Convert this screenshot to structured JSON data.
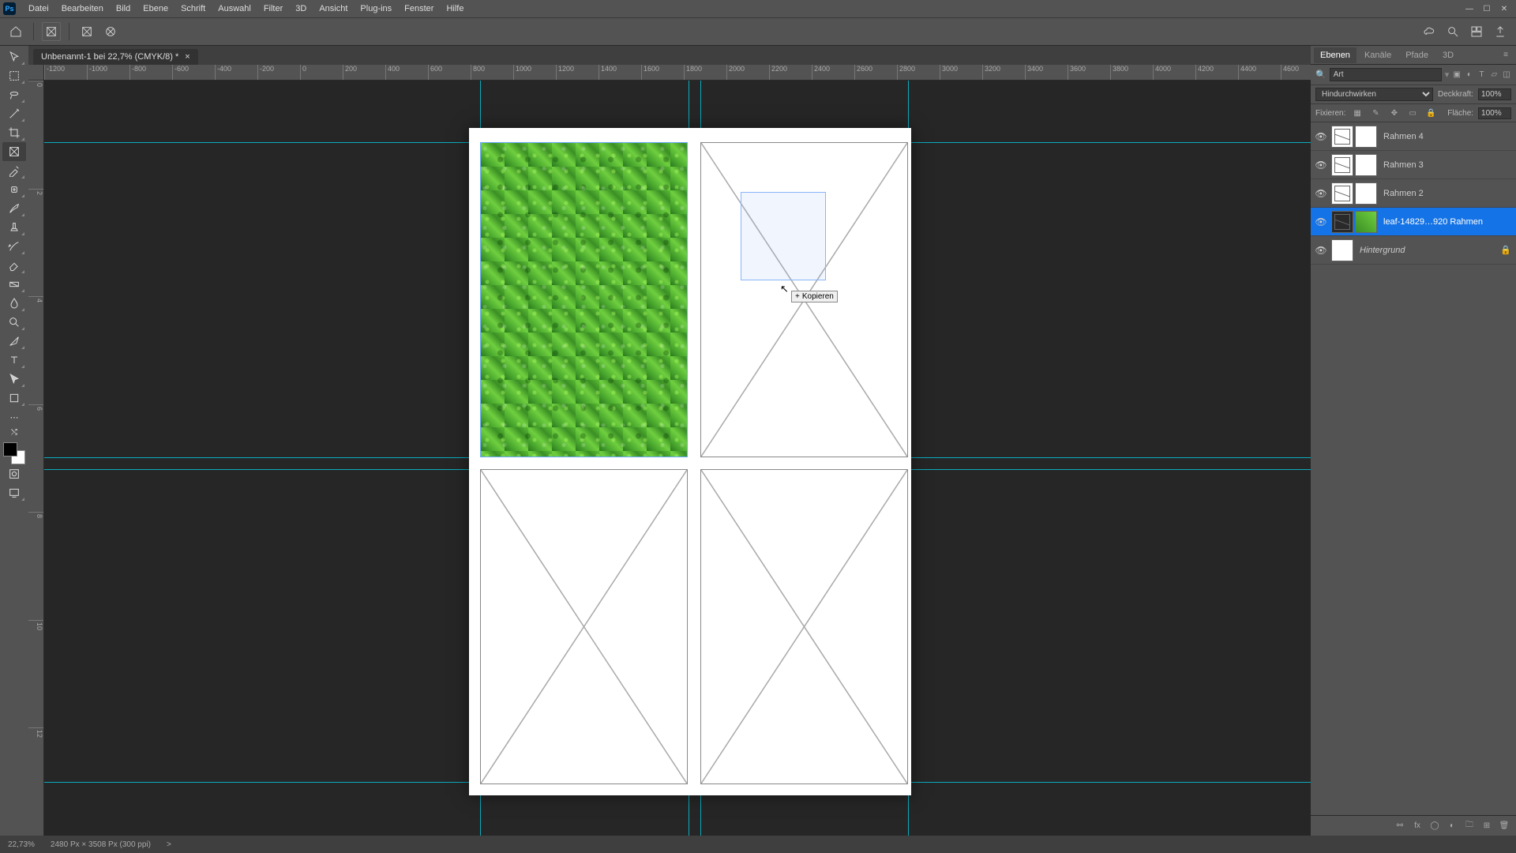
{
  "app": {
    "logo": "Ps"
  },
  "menu": [
    "Datei",
    "Bearbeiten",
    "Bild",
    "Ebene",
    "Schrift",
    "Auswahl",
    "Filter",
    "3D",
    "Ansicht",
    "Plug-ins",
    "Fenster",
    "Hilfe"
  ],
  "doc_tab": {
    "title": "Unbenannt-1 bei 22,7% (CMYK/8) *",
    "close": "×"
  },
  "ruler_h": [
    "-1200",
    "-1000",
    "-800",
    "-600",
    "-400",
    "-200",
    "0",
    "200",
    "400",
    "600",
    "800",
    "1000",
    "1200",
    "1400",
    "1600",
    "1800",
    "2000",
    "2200",
    "2400",
    "2600",
    "2800",
    "3000",
    "3200",
    "3400",
    "3600",
    "3800",
    "4000",
    "4200",
    "4400",
    "4600"
  ],
  "ruler_v": [
    "0",
    "2",
    "4",
    "6",
    "8",
    "10",
    "12"
  ],
  "tooltip": {
    "label": "Kopieren",
    "plus": "+"
  },
  "panels": {
    "tabs": [
      "Ebenen",
      "Kanäle",
      "Pfade",
      "3D"
    ],
    "search_placeholder": "Art",
    "blend_mode": "Hindurchwirken",
    "opacity_label": "Deckkraft:",
    "opacity_value": "100%",
    "lock_label": "Fixieren:",
    "fill_label": "Fläche:",
    "fill_value": "100%"
  },
  "layers": [
    {
      "name": "Rahmen 4",
      "selected": false,
      "thumbs": [
        "frame",
        "white"
      ],
      "locked": false
    },
    {
      "name": "Rahmen 3",
      "selected": false,
      "thumbs": [
        "frame",
        "white"
      ],
      "locked": false
    },
    {
      "name": "Rahmen 2",
      "selected": false,
      "thumbs": [
        "frame",
        "white"
      ],
      "locked": false
    },
    {
      "name": "leaf-14829…920 Rahmen",
      "selected": true,
      "thumbs": [
        "frame-green",
        "green"
      ],
      "locked": false
    },
    {
      "name": "Hintergrund",
      "selected": false,
      "thumbs": [
        "white"
      ],
      "locked": true,
      "italic": true
    }
  ],
  "status": {
    "zoom": "22,73%",
    "info": "2480 Px × 3508 Px (300 ppi)",
    "arrow": ">"
  }
}
